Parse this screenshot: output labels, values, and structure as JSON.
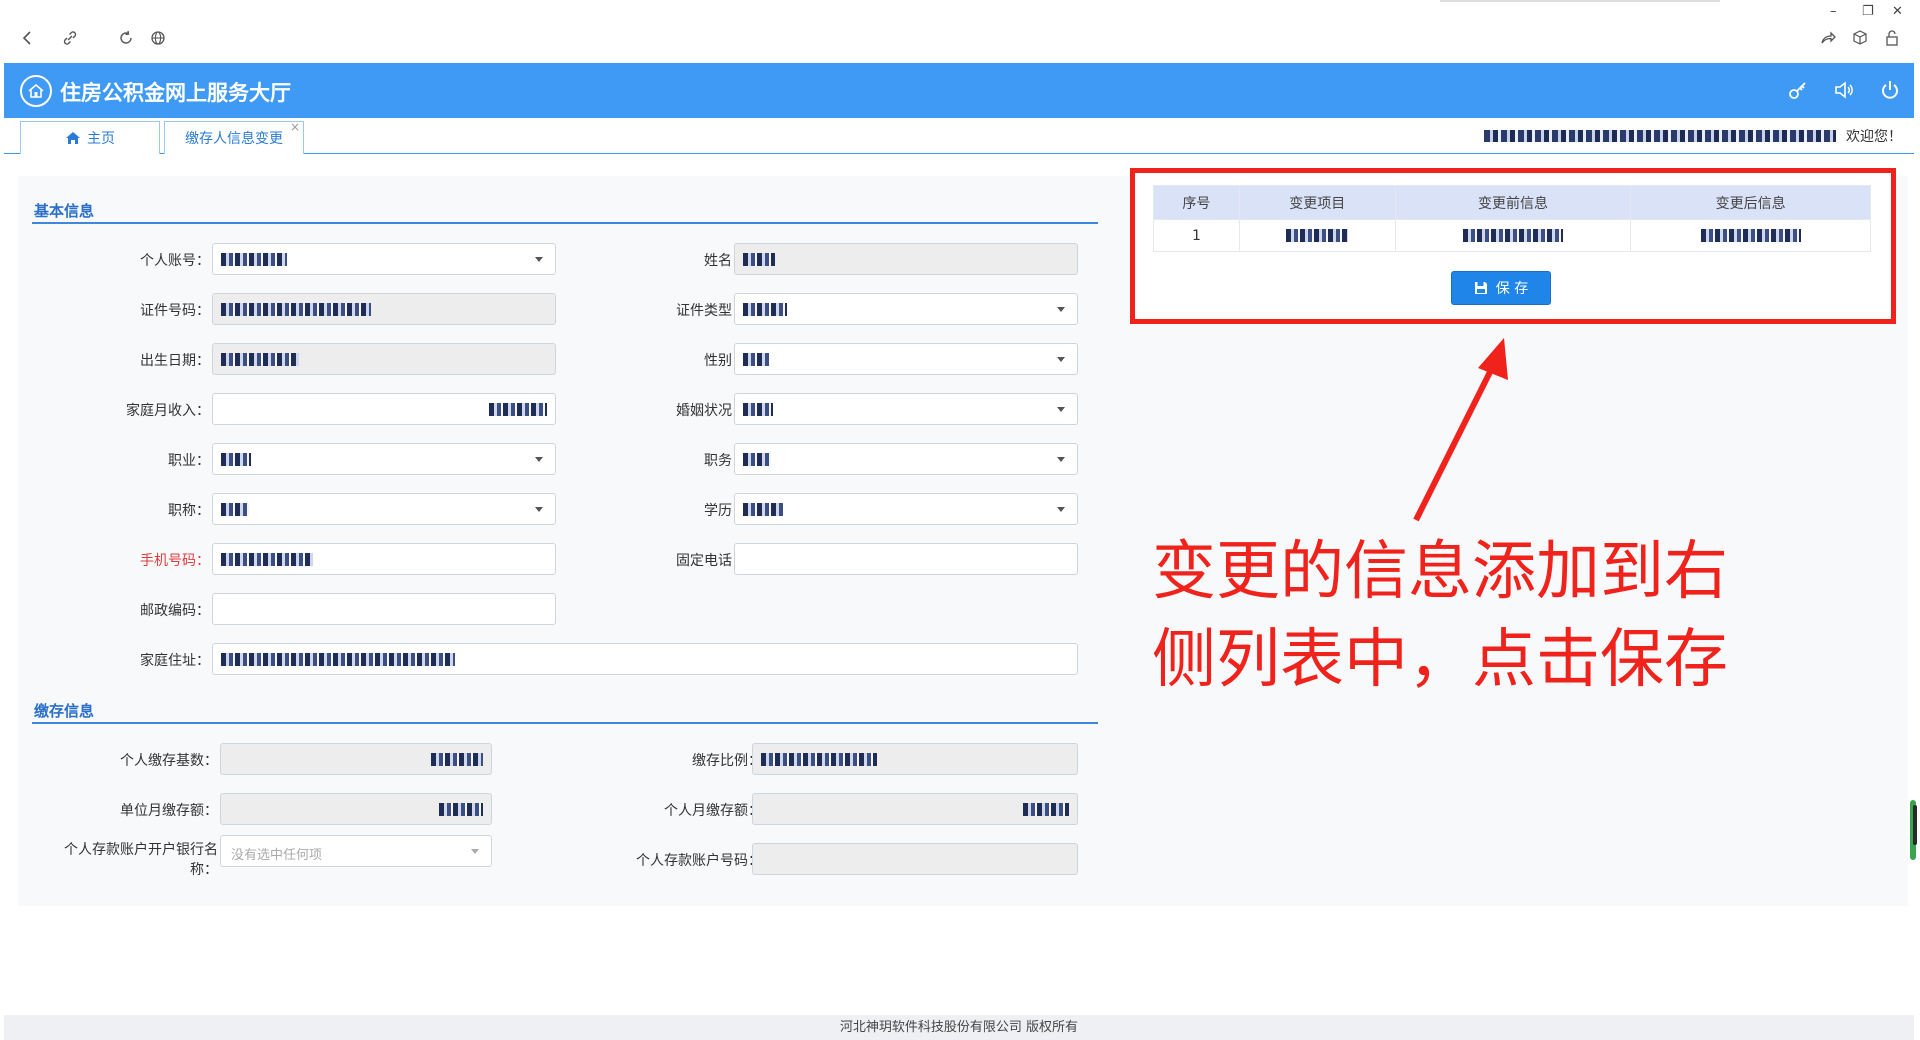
{
  "browser": {
    "icons": [
      "back-icon",
      "link-icon",
      "refresh-icon",
      "globe-icon",
      "share-icon",
      "box-icon",
      "lock-icon"
    ],
    "window_controls": [
      "–",
      "❐",
      "✕"
    ]
  },
  "header": {
    "title": "住房公积金网上服务大厅",
    "icons": [
      "key-icon",
      "speaker-icon",
      "power-icon"
    ]
  },
  "tabs": {
    "home": "主页",
    "active": "缴存人信息变更",
    "close": "×",
    "welcome": "欢迎您！"
  },
  "basic_section": {
    "title": "基本信息",
    "fields": {
      "account_label": "个人账号：",
      "name_label": "姓名：",
      "id_number_label": "证件号码：",
      "id_type_label": "证件类型：",
      "birth_label": "出生日期：",
      "gender_label": "性别：",
      "income_label": "家庭月收入：",
      "marital_label": "婚姻状况：",
      "occupation_label": "职业：",
      "position_label": "职务：",
      "title_label": "职称：",
      "education_label": "学历：",
      "mobile_label": "手机号码：",
      "phone_label": "固定电话：",
      "postcode_label": "邮政编码：",
      "address_label": "家庭住址："
    }
  },
  "deposit_section": {
    "title": "缴存信息",
    "fields": {
      "base_label": "个人缴存基数：",
      "ratio_label": "缴存比例：",
      "unit_monthly_label": "单位月缴存额：",
      "personal_monthly_label": "个人月缴存额：",
      "bank_name_label": "个人存款账户开户银行名称：",
      "bank_name_placeholder": "没有选中任何项",
      "bank_account_label": "个人存款账户号码："
    }
  },
  "change_table": {
    "headers": [
      "序号",
      "变更项目",
      "变更前信息",
      "变更后信息"
    ],
    "rows": [
      {
        "index": "1"
      }
    ],
    "save_label": "保  存"
  },
  "annotation": {
    "line1": "变更的信息添加到右",
    "line2": "侧列表中，点击保存"
  },
  "footer": {
    "text": "河北神玥软件科技股份有限公司 版权所有"
  },
  "colors": {
    "header_blue": "#3f9af5",
    "section_blue": "#2a6fc9",
    "annotation_red": "#f0231c",
    "button_blue": "#1f85e8"
  }
}
